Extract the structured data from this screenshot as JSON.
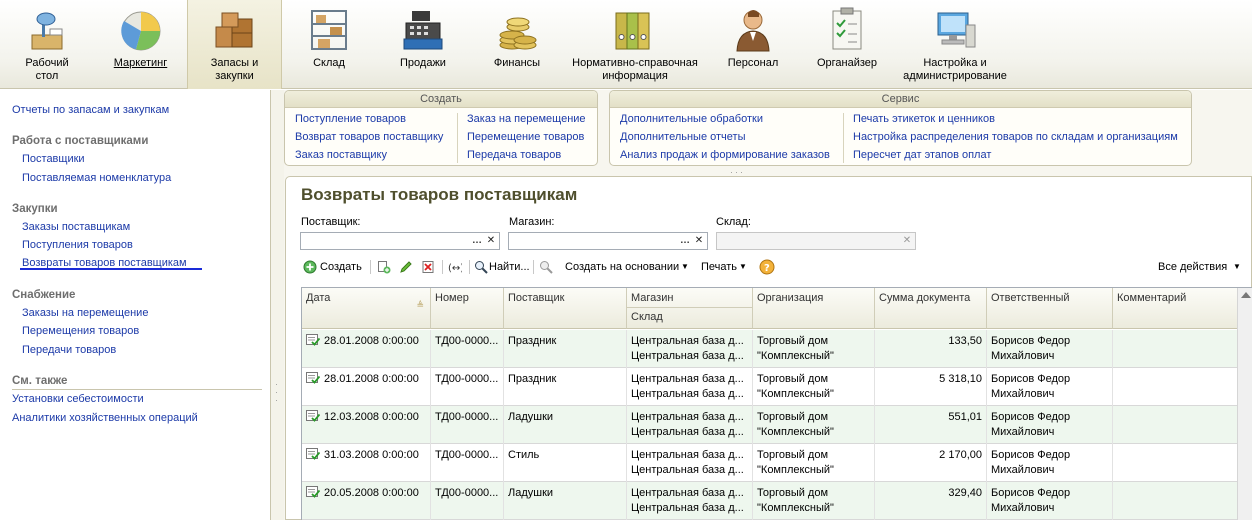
{
  "sections": [
    {
      "label": "Рабочий\nстол",
      "icon": "desktop-icon"
    },
    {
      "label": "Маркетинг",
      "icon": "pie-chart-icon"
    },
    {
      "label": "Запасы и\nзакупки",
      "icon": "boxes-icon"
    },
    {
      "label": "Склад",
      "icon": "shelf-icon"
    },
    {
      "label": "Продажи",
      "icon": "cash-register-icon"
    },
    {
      "label": "Финансы",
      "icon": "coins-icon"
    },
    {
      "label": "Нормативно-справочная\nинформация",
      "icon": "binders-icon"
    },
    {
      "label": "Персонал",
      "icon": "person-icon"
    },
    {
      "label": "Органайзер",
      "icon": "checklist-icon"
    },
    {
      "label": "Настройка и\nадминистрирование",
      "icon": "computer-icon"
    }
  ],
  "left": {
    "top_link": "Отчеты по запасам и закупкам",
    "groups": [
      {
        "title": "Работа с поставщиками",
        "items": [
          "Поставщики",
          "Поставляемая номенклатура"
        ]
      },
      {
        "title": "Закупки",
        "items": [
          "Заказы поставщикам",
          "Поступления товаров",
          "Возвраты товаров поставщикам"
        ]
      },
      {
        "title": "Снабжение",
        "items": [
          "Заказы на перемещение",
          "Перемещения товаров",
          "Передачи товаров"
        ]
      },
      {
        "title": "См. также",
        "items": [
          "Установки себестоимости",
          "Аналитики хозяйственных операций"
        ]
      }
    ]
  },
  "create": {
    "title": "Создать",
    "col1": [
      "Поступление товаров",
      "Возврат товаров поставщику",
      "Заказ поставщику"
    ],
    "col2": [
      "Заказ на перемещение",
      "Перемещение товаров",
      "Передача товаров"
    ]
  },
  "service": {
    "title": "Сервис",
    "col1": [
      "Дополнительные обработки",
      "Дополнительные отчеты",
      "Анализ продаж и формирование заказов"
    ],
    "col2": [
      "Печать этикеток и ценников",
      "Настройка распределения товаров по складам и организациям",
      "Пересчет дат этапов оплат"
    ]
  },
  "form": {
    "title": "Возвраты товаров поставщикам",
    "filters": {
      "supplier_label": "Поставщик:",
      "store_label": "Магазин:",
      "warehouse_label": "Склад:",
      "supplier_value": "",
      "store_value": "",
      "warehouse_value": ""
    },
    "toolbar": {
      "create": "Создать",
      "find": "Найти...",
      "create_based": "Создать на основании",
      "print": "Печать",
      "all_actions": "Все действия"
    },
    "columns": {
      "date": "Дата",
      "number": "Номер",
      "supplier": "Поставщик",
      "store": "Магазин",
      "warehouse": "Склад",
      "organization": "Организация",
      "sum": "Сумма документа",
      "responsible": "Ответственный",
      "comment": "Комментарий"
    },
    "rows": [
      {
        "date": "28.01.2008 0:00:00",
        "number": "ТД00-0000...",
        "supplier": "Праздник",
        "store": "Центральная база д...",
        "warehouse": "Центральная база д...",
        "org1": "Торговый дом",
        "org2": "\"Комплексный\"",
        "sum": "133,50",
        "resp1": "Борисов Федор",
        "resp2": "Михайлович",
        "comment": ""
      },
      {
        "date": "28.01.2008 0:00:00",
        "number": "ТД00-0000...",
        "supplier": "Праздник",
        "store": "Центральная база д...",
        "warehouse": "Центральная база д...",
        "org1": "Торговый дом",
        "org2": "\"Комплексный\"",
        "sum": "5 318,10",
        "resp1": "Борисов Федор",
        "resp2": "Михайлович",
        "comment": ""
      },
      {
        "date": "12.03.2008 0:00:00",
        "number": "ТД00-0000...",
        "supplier": "Ладушки",
        "store": "Центральная база д...",
        "warehouse": "Центральная база д...",
        "org1": "Торговый дом",
        "org2": "\"Комплексный\"",
        "sum": "551,01",
        "resp1": "Борисов Федор",
        "resp2": "Михайлович",
        "comment": ""
      },
      {
        "date": "31.03.2008 0:00:00",
        "number": "ТД00-0000...",
        "supplier": "Стиль",
        "store": "Центральная база д...",
        "warehouse": "Центральная база д...",
        "org1": "Торговый дом",
        "org2": "\"Комплексный\"",
        "sum": "2 170,00",
        "resp1": "Борисов Федор",
        "resp2": "Михайлович",
        "comment": ""
      },
      {
        "date": "20.05.2008 0:00:00",
        "number": "ТД00-0000...",
        "supplier": "Ладушки",
        "store": "Центральная база д...",
        "warehouse": "Центральная база д...",
        "org1": "Торговый дом",
        "org2": "\"Комплексный\"",
        "sum": "329,40",
        "resp1": "Борисов Федор",
        "resp2": "Михайлович",
        "comment": ""
      }
    ]
  }
}
